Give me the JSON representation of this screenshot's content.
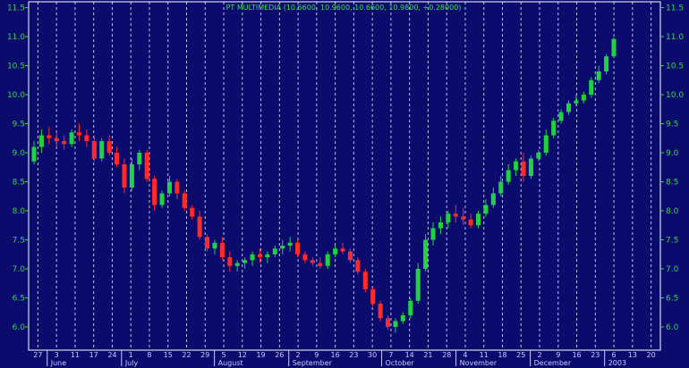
{
  "chart_data": {
    "type": "candlestick",
    "title": "PT MULTIMEDIA (10.6600, 10.9600, 10.6600, 10.9800, +0.28000)",
    "ylim": [
      5.6,
      11.6
    ],
    "y_ticks": [
      6.0,
      6.5,
      7.0,
      7.5,
      8.0,
      8.5,
      9.0,
      9.5,
      10.0,
      10.5,
      11.0,
      11.5
    ],
    "y_tick_labels": [
      "6.0",
      "6.5",
      "7.0",
      "7.5",
      "8.0",
      "8.5",
      "9.0",
      "9.5",
      "10.0",
      "10.5",
      "11.0",
      "11.5"
    ],
    "x_tick_labels": [
      "27",
      "3",
      "11",
      "17",
      "24",
      "1",
      "8",
      "15",
      "22",
      "29",
      "5",
      "12",
      "19",
      "26",
      "2",
      "9",
      "16",
      "23",
      "30",
      "7",
      "14",
      "21",
      "28",
      "4",
      "11",
      "18",
      "25",
      "2",
      "9",
      "16",
      "23",
      "6",
      "13",
      "20"
    ],
    "months": [
      "June",
      "July",
      "August",
      "September",
      "October",
      "November",
      "December",
      "2003"
    ],
    "month_tick_index": [
      1,
      5,
      10,
      14,
      19,
      23,
      27,
      31
    ],
    "grid": "vertical-dashed",
    "series": [
      {
        "values": [
          [
            8.85,
            9.2,
            8.8,
            9.1
          ],
          [
            9.1,
            9.4,
            9.0,
            9.3
          ],
          [
            9.3,
            9.45,
            9.15,
            9.25
          ],
          [
            9.25,
            9.35,
            9.1,
            9.2
          ],
          [
            9.2,
            9.3,
            9.05,
            9.15
          ],
          [
            9.15,
            9.4,
            9.1,
            9.35
          ],
          [
            9.35,
            9.5,
            9.2,
            9.3
          ],
          [
            9.3,
            9.4,
            9.1,
            9.2
          ],
          [
            9.2,
            9.3,
            8.85,
            8.9
          ],
          [
            8.9,
            9.25,
            8.85,
            9.2
          ],
          [
            9.2,
            9.3,
            8.95,
            9.0
          ],
          [
            9.0,
            9.1,
            8.75,
            8.8
          ],
          [
            8.8,
            8.9,
            8.3,
            8.4
          ],
          [
            8.4,
            8.9,
            8.35,
            8.8
          ],
          [
            8.8,
            9.05,
            8.7,
            9.0
          ],
          [
            9.0,
            9.05,
            8.5,
            8.55
          ],
          [
            8.55,
            8.6,
            8.0,
            8.1
          ],
          [
            8.1,
            8.35,
            8.05,
            8.3
          ],
          [
            8.3,
            8.6,
            8.25,
            8.5
          ],
          [
            8.5,
            8.55,
            8.2,
            8.3
          ],
          [
            8.3,
            8.35,
            8.0,
            8.05
          ],
          [
            8.05,
            8.1,
            7.85,
            7.9
          ],
          [
            7.9,
            8.0,
            7.5,
            7.55
          ],
          [
            7.55,
            7.6,
            7.3,
            7.35
          ],
          [
            7.35,
            7.5,
            7.25,
            7.45
          ],
          [
            7.45,
            7.55,
            7.15,
            7.2
          ],
          [
            7.2,
            7.3,
            6.95,
            7.05
          ],
          [
            7.05,
            7.15,
            6.95,
            7.1
          ],
          [
            7.1,
            7.2,
            7.0,
            7.15
          ],
          [
            7.15,
            7.3,
            7.05,
            7.25
          ],
          [
            7.25,
            7.35,
            7.1,
            7.2
          ],
          [
            7.2,
            7.3,
            7.1,
            7.25
          ],
          [
            7.25,
            7.4,
            7.2,
            7.35
          ],
          [
            7.35,
            7.5,
            7.25,
            7.4
          ],
          [
            7.4,
            7.55,
            7.3,
            7.45
          ],
          [
            7.45,
            7.5,
            7.2,
            7.25
          ],
          [
            7.25,
            7.3,
            7.1,
            7.15
          ],
          [
            7.15,
            7.2,
            7.05,
            7.1
          ],
          [
            7.1,
            7.2,
            7.0,
            7.05
          ],
          [
            7.05,
            7.3,
            7.0,
            7.25
          ],
          [
            7.25,
            7.4,
            7.2,
            7.35
          ],
          [
            7.35,
            7.45,
            7.25,
            7.3
          ],
          [
            7.3,
            7.35,
            7.1,
            7.15
          ],
          [
            7.15,
            7.2,
            6.9,
            6.95
          ],
          [
            6.95,
            7.0,
            6.6,
            6.65
          ],
          [
            6.65,
            6.7,
            6.35,
            6.4
          ],
          [
            6.4,
            6.45,
            6.1,
            6.15
          ],
          [
            6.15,
            6.2,
            5.95,
            6.0
          ],
          [
            6.0,
            6.15,
            5.9,
            6.1
          ],
          [
            6.1,
            6.25,
            6.05,
            6.2
          ],
          [
            6.2,
            6.5,
            6.15,
            6.45
          ],
          [
            6.45,
            7.1,
            6.4,
            7.0
          ],
          [
            7.0,
            7.6,
            6.95,
            7.5
          ],
          [
            7.5,
            7.8,
            7.4,
            7.7
          ],
          [
            7.7,
            7.9,
            7.6,
            7.8
          ],
          [
            7.8,
            8.0,
            7.7,
            7.95
          ],
          [
            7.95,
            8.1,
            7.8,
            7.9
          ],
          [
            7.9,
            8.05,
            7.75,
            7.85
          ],
          [
            7.85,
            7.95,
            7.7,
            7.75
          ],
          [
            7.75,
            8.0,
            7.7,
            7.95
          ],
          [
            7.95,
            8.2,
            7.9,
            8.1
          ],
          [
            8.1,
            8.4,
            8.05,
            8.3
          ],
          [
            8.3,
            8.6,
            8.25,
            8.5
          ],
          [
            8.5,
            8.8,
            8.45,
            8.7
          ],
          [
            8.7,
            8.9,
            8.6,
            8.85
          ],
          [
            8.85,
            9.0,
            8.5,
            8.6
          ],
          [
            8.6,
            8.95,
            8.55,
            8.9
          ],
          [
            8.9,
            9.05,
            8.85,
            9.0
          ],
          [
            9.0,
            9.4,
            8.95,
            9.3
          ],
          [
            9.3,
            9.6,
            9.25,
            9.55
          ],
          [
            9.55,
            9.75,
            9.5,
            9.7
          ],
          [
            9.7,
            9.9,
            9.65,
            9.85
          ],
          [
            9.85,
            10.0,
            9.8,
            9.9
          ],
          [
            9.9,
            10.05,
            9.85,
            10.0
          ],
          [
            10.0,
            10.3,
            9.95,
            10.25
          ],
          [
            10.25,
            10.5,
            10.2,
            10.4
          ],
          [
            10.4,
            10.7,
            10.35,
            10.66
          ],
          [
            10.66,
            10.98,
            10.66,
            10.96
          ]
        ]
      }
    ]
  }
}
